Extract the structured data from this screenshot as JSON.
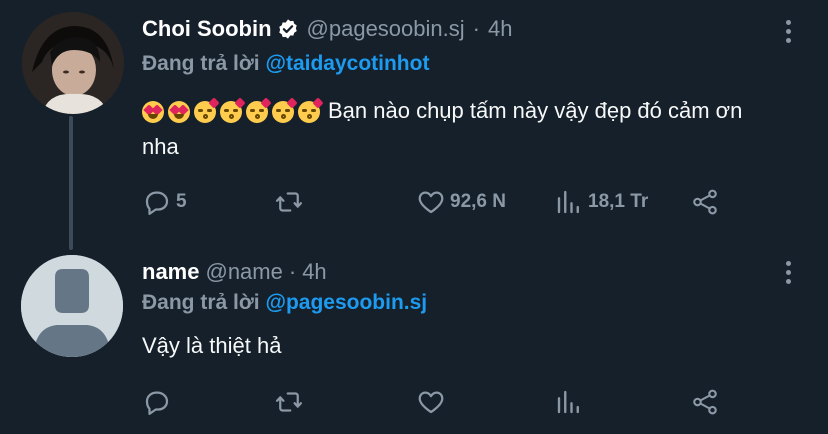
{
  "thread": [
    {
      "display_name": "Choi Soobin",
      "verified": true,
      "handle": "@pagesoobin.sj",
      "separator": "·",
      "time": "4h",
      "replying_label": "Đang trả lời",
      "replying_to": "@taidaycotinhot",
      "text": "Bạn nào chụp tấm này vậy đẹp đó cảm ơn nha",
      "emojis": [
        "heart-eyes-emoji",
        "heart-eyes-emoji",
        "kiss-emoji",
        "kiss-emoji",
        "kiss-emoji",
        "kiss-emoji",
        "kiss-emoji"
      ],
      "actions": {
        "reply_count": "5",
        "retweet_count": "",
        "like_count": "92,6 N",
        "views_count": "18,1 Tr"
      }
    },
    {
      "display_name": "name",
      "verified": false,
      "handle": "@name",
      "separator": "·",
      "time": "4h",
      "replying_label": "Đang trả lời",
      "replying_to": "@pagesoobin.sj",
      "text": "Vậy là thiệt hả",
      "actions": {
        "reply_count": "",
        "retweet_count": "",
        "like_count": "",
        "views_count": ""
      }
    }
  ],
  "colors": {
    "background": "#15202b",
    "accent": "#1d9bf0",
    "secondary_text": "#8b98a5",
    "thread_line": "#3d4b59"
  },
  "icons": [
    "verified-badge-icon",
    "more-icon",
    "reply-icon",
    "retweet-icon",
    "like-icon",
    "views-icon",
    "share-icon"
  ]
}
